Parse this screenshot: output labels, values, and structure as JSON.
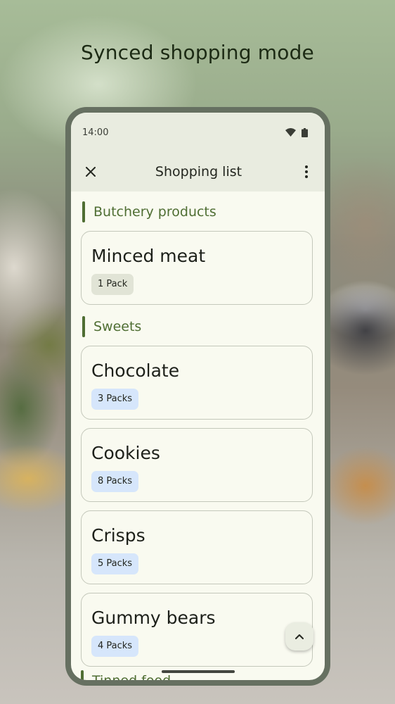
{
  "headline": "Synced shopping mode",
  "status_bar": {
    "time": "14:00"
  },
  "app_bar": {
    "title": "Shopping list"
  },
  "sections": [
    {
      "label": "Butchery products",
      "items": [
        {
          "name": "Minced meat",
          "quantity": "1 Pack"
        }
      ]
    },
    {
      "label": "Sweets",
      "items": [
        {
          "name": "Chocolate",
          "quantity": "3 Packs"
        },
        {
          "name": "Cookies",
          "quantity": "8 Packs"
        },
        {
          "name": "Crisps",
          "quantity": "5 Packs"
        },
        {
          "name": "Gummy bears",
          "quantity": "4 Packs"
        }
      ]
    },
    {
      "label": "Tinned food"
    }
  ],
  "colors": {
    "accent": "#4f6e33",
    "chip_neutral": "#e1e4d6",
    "chip_blue": "#d6e6fb",
    "surface": "#f9faf0",
    "app_bar": "#e9ece0"
  }
}
